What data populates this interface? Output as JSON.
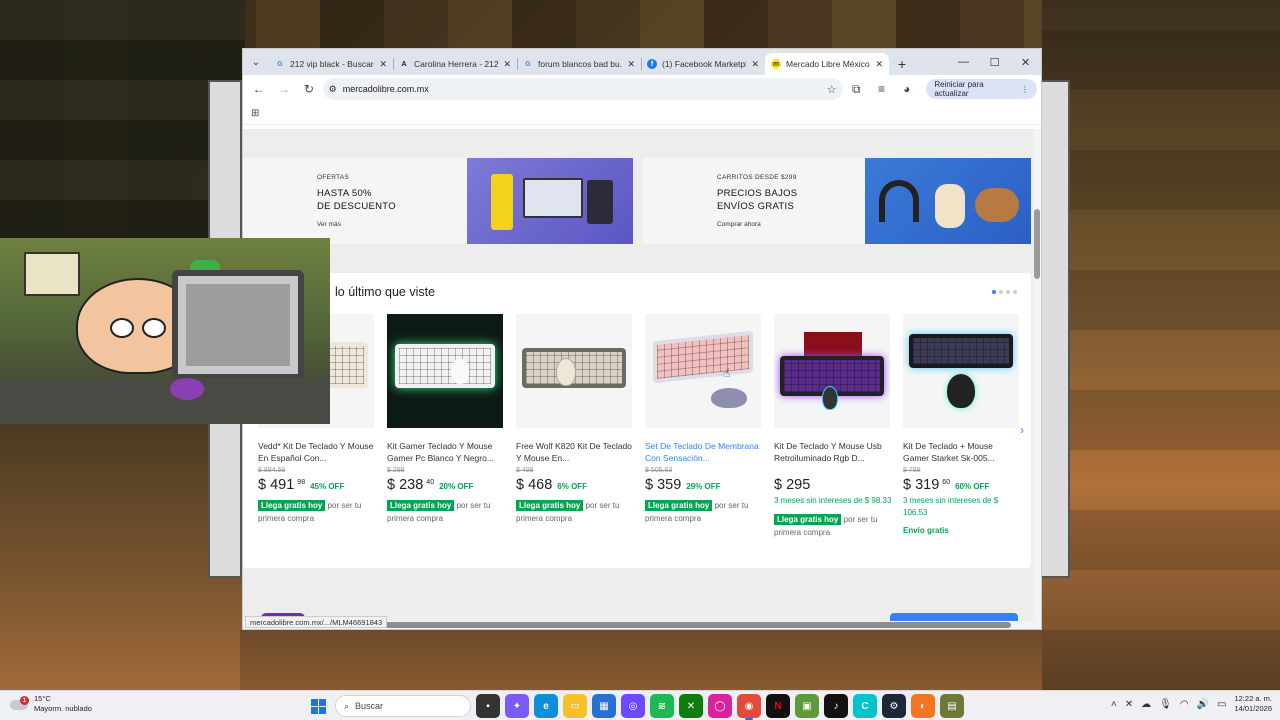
{
  "browser": {
    "tabs": [
      {
        "title": "212 vip black - Buscar",
        "favicon": "G",
        "color": "#4285f4",
        "active": false
      },
      {
        "title": "Carolina Herrera - 212...",
        "favicon": "A",
        "color": "#222222",
        "active": false
      },
      {
        "title": "forum blancos bad bu...",
        "favicon": "G",
        "color": "#4285f4",
        "active": false
      },
      {
        "title": "(1) Facebook Marketpl...",
        "favicon": "f",
        "color": "#1877f2",
        "active": false
      },
      {
        "title": "Mercado Libre México",
        "favicon": "m",
        "color": "#ffe600",
        "active": true
      }
    ],
    "new_tab": "+",
    "window_controls": {
      "minimize": "—",
      "maximize": "☐",
      "close": "✕"
    },
    "url": "mercadolibre.com.mx",
    "update_button": "Reiniciar para actualizar",
    "status_url": "mercadolibre.com.mx/.../MLM46691843"
  },
  "banners": [
    {
      "kicker": "OFERTAS",
      "headline_1": "HASTA 50%",
      "headline_2": "DE DESCUENTO",
      "cta": "Ver más"
    },
    {
      "kicker": "CARRITOS DESDE $299",
      "headline_1": "PRECIOS BAJOS",
      "headline_2": "ENVÍOS GRATIS",
      "cta": "Comprar ahora"
    }
  ],
  "section": {
    "title": "lo último que viste"
  },
  "products": [
    {
      "name": "Vedd* Kit De Teclado Y Mouse En Español Con...",
      "old_price": "$ 894.59",
      "price": "$ 491",
      "cents": "98",
      "discount": "45% OFF",
      "installments": "",
      "badge": "Llega gratis hoy",
      "ship_suffix": "por ser tu primera compra",
      "free_shipping": "",
      "visited": false
    },
    {
      "name": "Kit Gamer Teclado Y Mouse Gamer Pc Blanco Y Negro...",
      "old_price": "$ 298",
      "price": "$ 238",
      "cents": "40",
      "discount": "20% OFF",
      "installments": "",
      "badge": "Llega gratis hoy",
      "ship_suffix": "por ser tu primera compra",
      "free_shipping": "",
      "visited": false
    },
    {
      "name": "Free Wolf K820 Kit De Teclado Y Mouse En...",
      "old_price": "$ 499",
      "price": "$ 468",
      "cents": "",
      "discount": "6% OFF",
      "installments": "",
      "badge": "Llega gratis hoy",
      "ship_suffix": "por ser tu primera compra",
      "free_shipping": "",
      "visited": false
    },
    {
      "name": "Set De Teclado De Membrana Con Sensación...",
      "old_price": "$ 505.63",
      "price": "$ 359",
      "cents": "",
      "discount": "29% OFF",
      "installments": "",
      "badge": "Llega gratis hoy",
      "ship_suffix": "por ser tu primera compra",
      "free_shipping": "",
      "visited": true
    },
    {
      "name": "Kit De Teclado Y Mouse Usb Retroiluminado Rgb D...",
      "old_price": "",
      "price": "$ 295",
      "cents": "",
      "discount": "",
      "installments": "3 meses sin intereses de $ 98.33",
      "badge": "Llega gratis hoy",
      "ship_suffix": "por ser tu primera compra",
      "free_shipping": "",
      "visited": false
    },
    {
      "name": "Kit De Teclado + Mouse Gamer Starket Sk-005...",
      "old_price": "$ 799",
      "price": "$ 319",
      "cents": "60",
      "discount": "60% OFF",
      "installments": "3 meses sin intereses de $ 106.53",
      "badge": "",
      "ship_suffix": "",
      "free_shipping": "Envío gratis",
      "visited": false
    }
  ],
  "taskbar": {
    "weather_temp": "15°C",
    "weather_desc": "Mayorm. nublado",
    "weather_alert": "1",
    "search_placeholder": "Buscar",
    "time": "12:22 a. m.",
    "date": "14/01/2026",
    "apps": [
      {
        "name": "file-explorer",
        "color": "#f2b01e",
        "glyph": "▬"
      },
      {
        "name": "copilot",
        "color": "#7a5af8",
        "glyph": "✦"
      },
      {
        "name": "edge",
        "color": "#0f8fd8",
        "glyph": "e"
      },
      {
        "name": "folder",
        "color": "#f5c02a",
        "glyph": "▭"
      },
      {
        "name": "store",
        "color": "#2a6fd6",
        "glyph": "▦"
      },
      {
        "name": "proton",
        "color": "#6d4aff",
        "glyph": "◎"
      },
      {
        "name": "spotify",
        "color": "#1db954",
        "glyph": "≋"
      },
      {
        "name": "xbox",
        "color": "#107c10",
        "glyph": "✕"
      },
      {
        "name": "instagram",
        "color": "#d6249f",
        "glyph": "◯"
      },
      {
        "name": "chrome",
        "color": "#e24a3a",
        "glyph": "◉"
      },
      {
        "name": "netflix",
        "color": "#e50914",
        "glyph": "N"
      },
      {
        "name": "minecraft",
        "color": "#5d9b3a",
        "glyph": "▣"
      },
      {
        "name": "tiktok",
        "color": "#111111",
        "glyph": "♪"
      },
      {
        "name": "canva",
        "color": "#00c4cc",
        "glyph": "C"
      },
      {
        "name": "steam",
        "color": "#1b2838",
        "glyph": "⚙"
      },
      {
        "name": "crunchyroll",
        "color": "#f47521",
        "glyph": "◐"
      },
      {
        "name": "minecraft-launcher",
        "color": "#6b7a3a",
        "glyph": "▤"
      }
    ]
  }
}
